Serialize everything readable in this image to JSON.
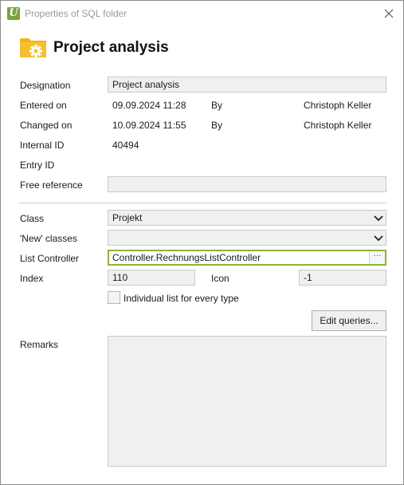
{
  "window": {
    "title": "Properties of SQL folder",
    "app_icon_glyph": "U",
    "accent_color": "#8cb33a"
  },
  "header": {
    "title": "Project analysis",
    "icon": "folder-gear-icon",
    "icon_color": "#f2b316"
  },
  "fields": {
    "designation": {
      "label": "Designation",
      "value": "Project analysis"
    },
    "entered_on": {
      "label": "Entered on",
      "date": "09.09.2024 11:28",
      "by_label": "By",
      "by": "Christoph Keller"
    },
    "changed_on": {
      "label": "Changed on",
      "date": "10.09.2024 11:55",
      "by_label": "By",
      "by": "Christoph Keller"
    },
    "internal_id": {
      "label": "Internal ID",
      "value": "40494"
    },
    "entry_id": {
      "label": "Entry ID",
      "value": ""
    },
    "free_reference": {
      "label": "Free reference",
      "value": ""
    },
    "class": {
      "label": "Class",
      "value": "Projekt"
    },
    "new_classes": {
      "label": "'New' classes",
      "value": ""
    },
    "list_controller": {
      "label": "List Controller",
      "value": "Controller.RechnungsListController",
      "ellipsis": "···"
    },
    "index": {
      "label": "Index",
      "value": "110"
    },
    "icon": {
      "label": "Icon",
      "value": "-1"
    },
    "individual_list": {
      "label": "Individual list for every type",
      "checked": false
    },
    "remarks": {
      "label": "Remarks",
      "value": ""
    }
  },
  "buttons": {
    "edit_queries": "Edit queries..."
  }
}
